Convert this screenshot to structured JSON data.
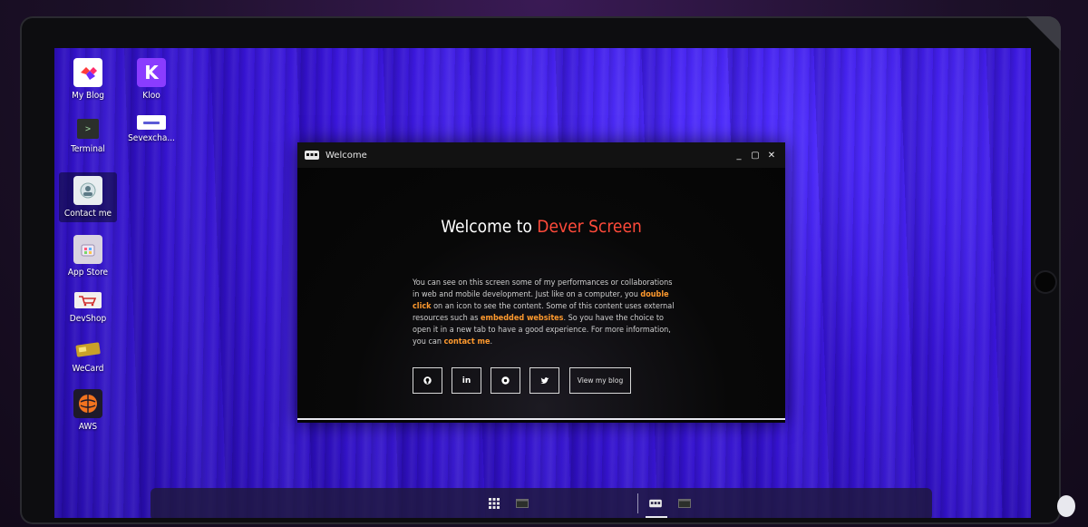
{
  "desktop": {
    "icons": [
      {
        "label": "My Blog",
        "icon": "my-blog-icon"
      },
      {
        "label": "Kloo",
        "icon": "kloo-icon"
      },
      {
        "label": "Terminal",
        "icon": "terminal-icon"
      },
      {
        "label": "Sevexcha...",
        "icon": "sevexchange-icon"
      },
      {
        "label": "Contact me",
        "icon": "contact-icon"
      },
      {
        "label": "App Store",
        "icon": "app-store-icon"
      },
      {
        "label": "DevShop",
        "icon": "devshop-icon"
      },
      {
        "label": "WeCard",
        "icon": "wecard-icon"
      },
      {
        "label": "AWS",
        "icon": "aws-icon"
      }
    ]
  },
  "window": {
    "title": "Welcome",
    "controls": {
      "minimize": "_",
      "maximize": "▢",
      "close": "✕"
    },
    "heading_prefix": "Welcome to ",
    "heading_accent": "Dever Screen",
    "paragraph": {
      "p1": "You can see on this screen some of my performances or collaborations in web and mobile development. Just like on a computer, you ",
      "em1": "double click",
      "p2": " on an icon to see the content. Some of this content uses external resources such as ",
      "em2": "embedded websites",
      "p3": ". So you have the choice to open it in a new tab to have a good experience. For more information, you can ",
      "em3": "contact me",
      "p4": "."
    },
    "links": {
      "github": "github-icon",
      "linkedin": "in",
      "other": "circle-logo-icon",
      "twitter": "twitter-icon",
      "blog_label": "View my blog"
    }
  },
  "colors": {
    "accent_red": "#ff4a3a",
    "accent_orange": "#ff9a2e",
    "wallpaper": "#3814d8"
  }
}
